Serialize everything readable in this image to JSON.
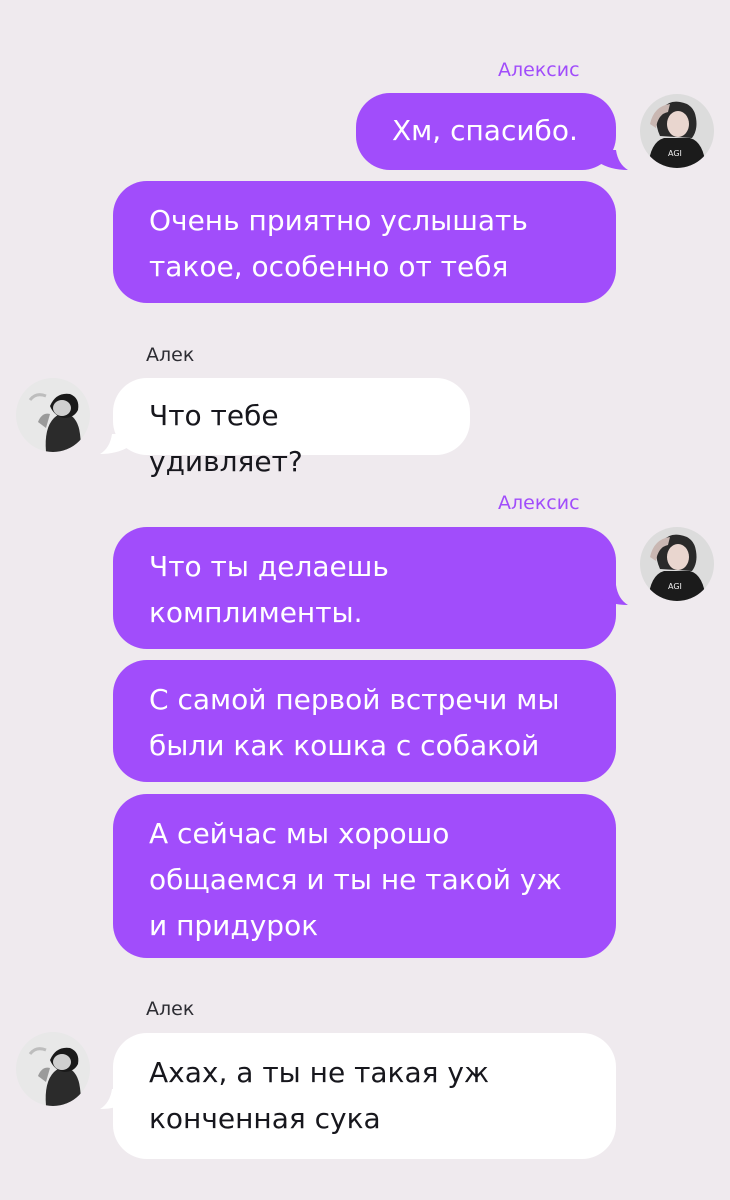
{
  "chat": {
    "blocks": [
      {
        "sender": "Алексис",
        "side": "right",
        "messages": [
          "Хм, спасибо.",
          "Очень приятно услышать\nтакое, особенно от тебя"
        ]
      },
      {
        "sender": "Алек",
        "side": "left",
        "messages": [
          "Что тебе удивляет?"
        ]
      },
      {
        "sender": "Алексис",
        "side": "right",
        "messages": [
          "Что ты делаешь\nкомплименты.",
          "С самой первой встречи мы\nбыли как кошка с собакой",
          "А сейчас мы хорошо\nобщаемся и ты не такой уж\nи придурок"
        ]
      },
      {
        "sender": "Алек",
        "side": "left",
        "messages": [
          "Ахах, а ты не такая уж\nконченная сука"
        ]
      }
    ]
  },
  "colors": {
    "background": "#efeaee",
    "outgoing_bubble": "#a14dfb",
    "incoming_bubble": "#ffffff",
    "accent_name": "#a14dfb"
  },
  "icons": {
    "alexis_avatar": "avatar-alexis-icon",
    "alek_avatar": "avatar-alek-icon"
  }
}
